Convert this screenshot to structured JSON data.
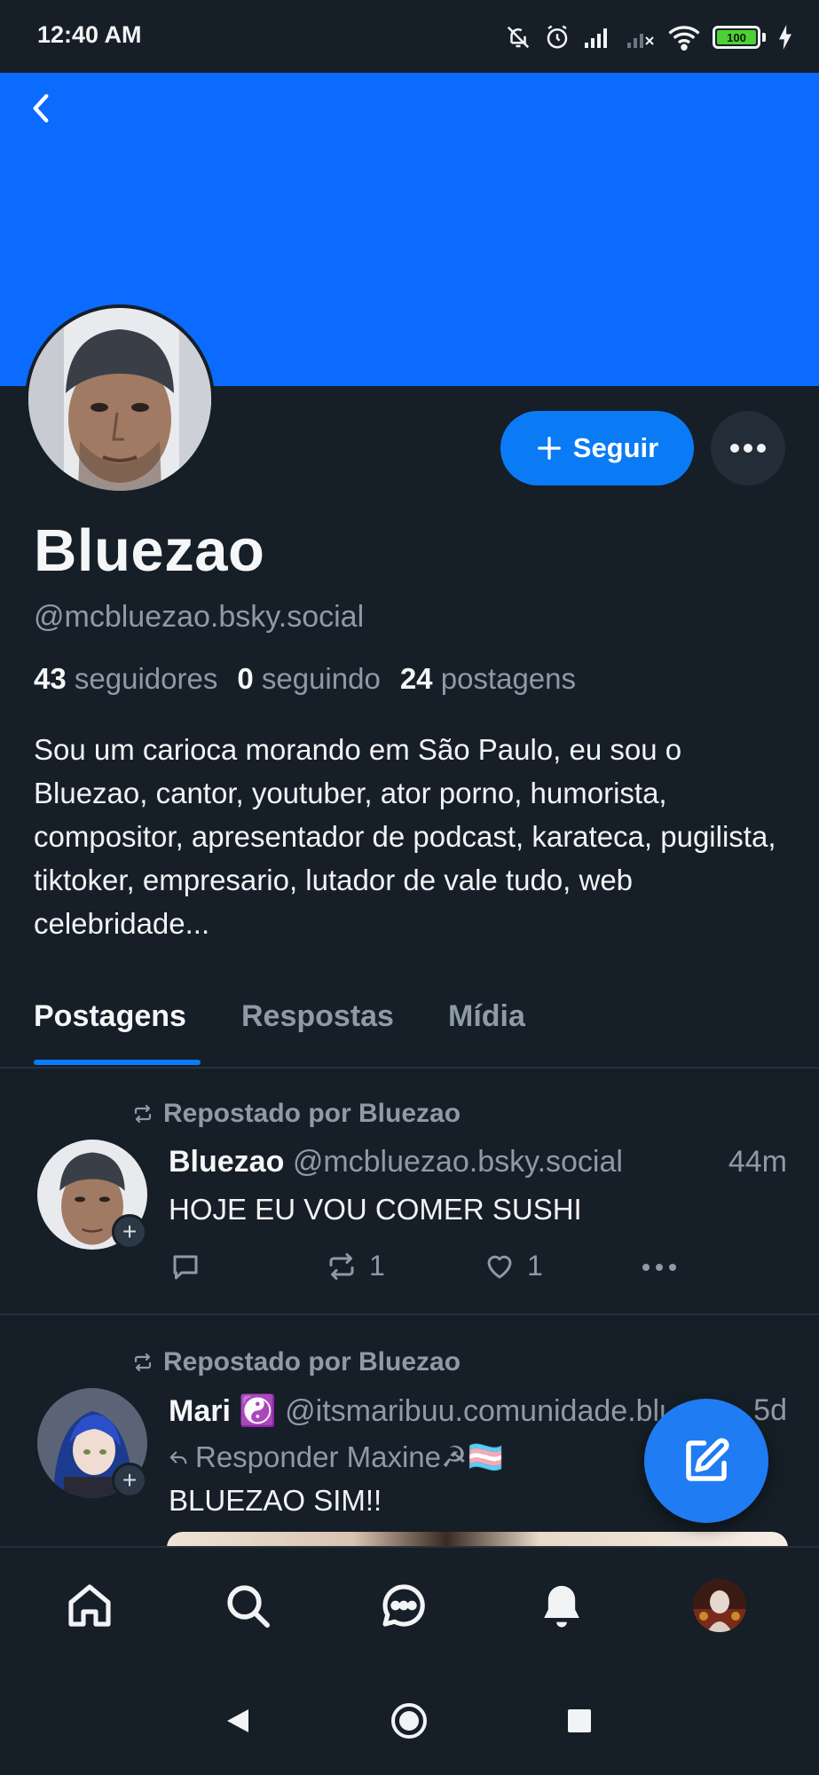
{
  "status_bar": {
    "time": "12:40 AM",
    "battery": "100"
  },
  "profile": {
    "display_name": "Bluezao",
    "handle": "@mcbluezao.bsky.social",
    "followers_count": "43",
    "followers_label": "seguidores",
    "following_count": "0",
    "following_label": "seguindo",
    "posts_count": "24",
    "posts_label": "postagens",
    "bio": "Sou um carioca morando em São Paulo, eu sou o Bluezao, cantor, youtuber, ator porno, humorista, compositor, apresentador de podcast, karateca, pugilista, tiktoker, empresario, lutador de vale tudo, web celebridade...",
    "follow_label": "Seguir",
    "banner_color": "#0b6bff"
  },
  "tabs": [
    {
      "label": "Postagens",
      "active": true
    },
    {
      "label": "Respostas",
      "active": false
    },
    {
      "label": "Mídia",
      "active": false
    }
  ],
  "posts": [
    {
      "repost_label": "Repostado por Bluezao",
      "author": "Bluezao",
      "handle": "@mcbluezao.bsky.social",
      "time": "44m",
      "text": "HOJE EU VOU COMER SUSHI",
      "reposts": "1",
      "likes": "1"
    },
    {
      "repost_label": "Repostado por Bluezao",
      "author": "Mari ☯️",
      "handle": "@itsmaribuu.comunidade.blue",
      "time": "5d",
      "reply_label": "Responder Maxine☭🏳️‍⚧️",
      "text": "BLUEZAO SIM!!"
    }
  ],
  "colors": {
    "accent": "#0a7bf5",
    "background": "#161e27",
    "muted_text": "#8e9aa8"
  }
}
